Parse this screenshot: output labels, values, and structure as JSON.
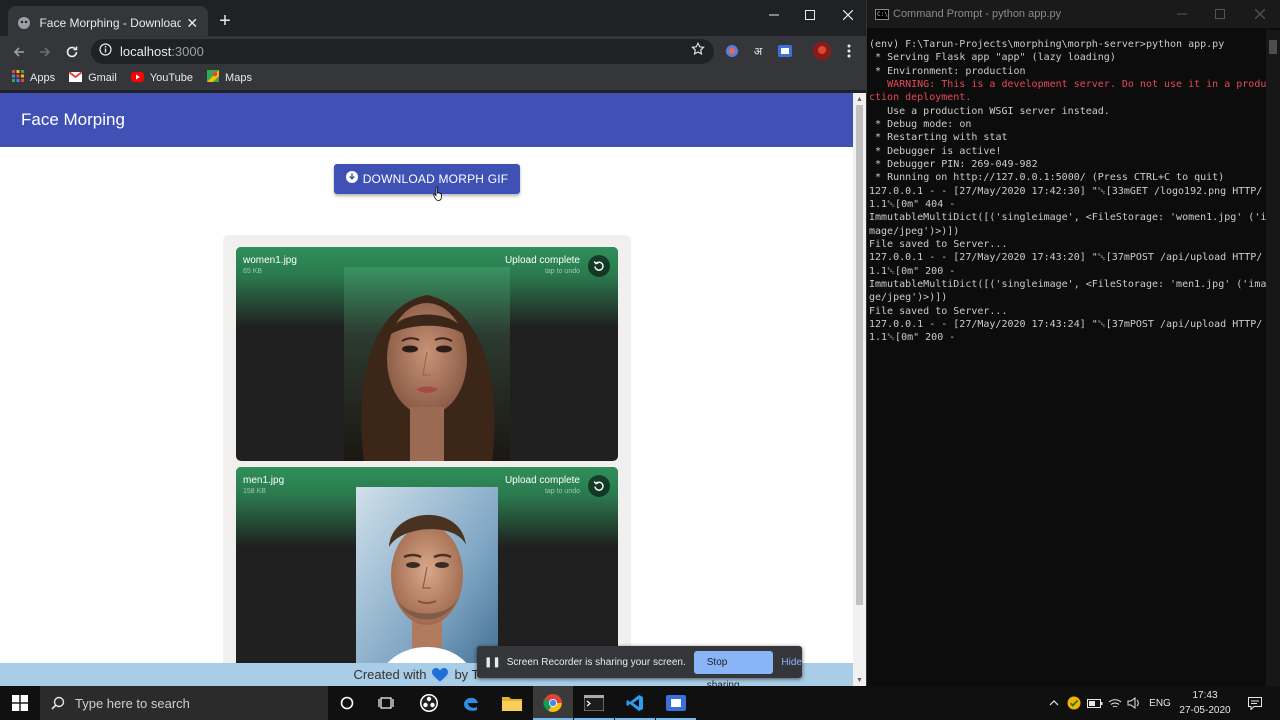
{
  "browser": {
    "tab_title": "Face Morphing - Download Morph",
    "new_tab_symbol": "+",
    "url_host": "localhost",
    "url_port": ":3000",
    "bookmarks": [
      {
        "label": "Apps",
        "icon": "apps-grid-icon"
      },
      {
        "label": "Gmail",
        "icon": "gmail-icon"
      },
      {
        "label": "YouTube",
        "icon": "youtube-icon"
      },
      {
        "label": "Maps",
        "icon": "maps-icon"
      }
    ],
    "extension_hindi": "अ"
  },
  "page": {
    "appbar_title": "Face Morping",
    "download_button_label": "DOWNLOAD MORPH GIF",
    "files": [
      {
        "name": "women1.jpg",
        "size": "65 KB",
        "status": "Upload complete",
        "substatus": "tap to undo"
      },
      {
        "name": "men1.jpg",
        "size": "158 KB",
        "status": "Upload complete",
        "substatus": "tap to undo"
      }
    ],
    "footer_prefix": "Created with",
    "footer_suffix": "by T"
  },
  "share_bar": {
    "pause_symbol": "❚❚",
    "message": "Screen Recorder is sharing your screen.",
    "stop_label": "Stop sharing",
    "hide_label": "Hide"
  },
  "cmd": {
    "title": "Command Prompt - python  app.py",
    "lines": [
      {
        "text": "(env) F:\\Tarun-Projects\\morphing\\morph-server>python app.py",
        "type": "normal"
      },
      {
        "text": " * Serving Flask app \"app\" (lazy loading)",
        "type": "normal"
      },
      {
        "text": " * Environment: production",
        "type": "normal"
      },
      {
        "text": "   WARNING: This is a development server. Do not use it in a production deployment.",
        "type": "warn"
      },
      {
        "text": "   Use a production WSGI server instead.",
        "type": "normal"
      },
      {
        "text": " * Debug mode: on",
        "type": "normal"
      },
      {
        "text": " * Restarting with stat",
        "type": "normal"
      },
      {
        "text": " * Debugger is active!",
        "type": "normal"
      },
      {
        "text": " * Debugger PIN: 269-049-982",
        "type": "normal"
      },
      {
        "text": " * Running on http://127.0.0.1:5000/ (Press CTRL+C to quit)",
        "type": "normal"
      },
      {
        "text": "127.0.0.1 - - [27/May/2020 17:42:30] \"␛[33mGET /logo192.png HTTP/1.1␛[0m\" 404 -",
        "type": "normal"
      },
      {
        "text": "ImmutableMultiDict([('singleimage', <FileStorage: 'women1.jpg' ('image/jpeg')>)])",
        "type": "normal"
      },
      {
        "text": "File saved to Server...",
        "type": "normal"
      },
      {
        "text": "127.0.0.1 - - [27/May/2020 17:43:20] \"␛[37mPOST /api/upload HTTP/1.1␛[0m\" 200 -",
        "type": "normal"
      },
      {
        "text": "ImmutableMultiDict([('singleimage', <FileStorage: 'men1.jpg' ('image/jpeg')>)])",
        "type": "normal"
      },
      {
        "text": "File saved to Server...",
        "type": "normal"
      },
      {
        "text": "127.0.0.1 - - [27/May/2020 17:43:24] \"␛[37mPOST /api/upload HTTP/1.1␛[0m\" 200 -",
        "type": "normal"
      }
    ]
  },
  "taskbar": {
    "search_placeholder": "Type here to search",
    "language": "ENG",
    "time": "17:43",
    "date": "27-05-2020"
  },
  "colors": {
    "appbar": "#3f51b5",
    "upload_success": "#2f8f5a",
    "warning_text": "#e74856",
    "share_accent": "#8ab4f8"
  }
}
